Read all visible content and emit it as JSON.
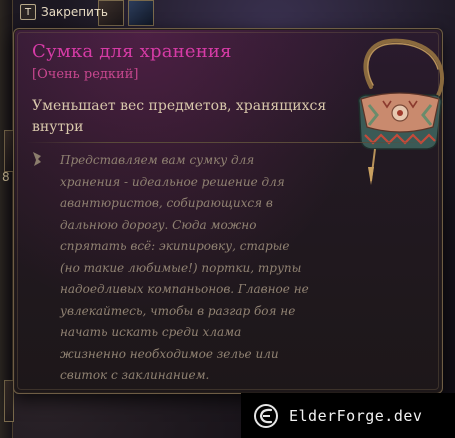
{
  "hud": {
    "pin_key": "T",
    "pin_label": "Закрепить",
    "side_number": "8"
  },
  "item": {
    "name": "Сумка для хранения",
    "rarity": "[Очень редкий]",
    "effect": "Уменьшает вес предметов, хранящихся внутри",
    "lore": "Представляем вам сумку для хранения - идеальное решение для авантюристов, собирающихся в дальнюю дорогу. Сюда можно спрятать всё: экипировку, старые (но такие любимые!) портки, трупы надоедливых компаньонов. Главное не увлекайтесь, чтобы в разгар боя не начать искать среди хлама жизненно необходимое зелье или свиток с заклинанием.",
    "art_icon": "bag-of-holding-icon",
    "lore_icon": "quill-icon"
  },
  "watermark": {
    "text": "ElderForge.dev",
    "logo_icon": "elderforge-logo-icon"
  },
  "colors": {
    "title": "#d63ba6",
    "rarity": "#c8478f",
    "effect": "#d8c7ab",
    "lore": "#908272",
    "border": "#6e5d45"
  }
}
